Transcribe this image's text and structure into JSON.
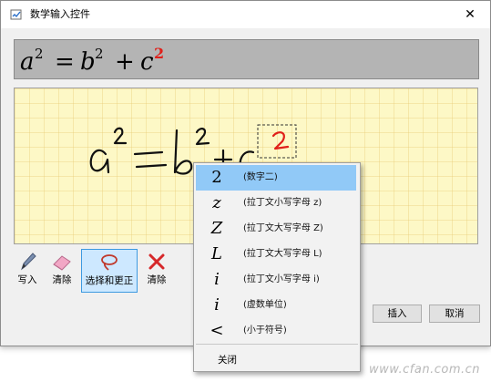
{
  "window": {
    "title": "数学输入控件",
    "close_glyph": "✕"
  },
  "preview": {
    "formula_parts": [
      "a",
      "2",
      "=",
      "b",
      "2",
      "+",
      "c",
      "2"
    ],
    "highlight_color": "#e0201a"
  },
  "toolbar": [
    {
      "label": "写入",
      "icon": "pen-icon",
      "selected": false
    },
    {
      "label": "清除",
      "icon": "eraser-icon",
      "selected": false
    },
    {
      "label": "选择和更正",
      "icon": "lasso-icon",
      "selected": true
    },
    {
      "label": "清除",
      "icon": "x-icon",
      "selected": false
    }
  ],
  "buttons": {
    "insert": "插入",
    "cancel": "取消"
  },
  "context_menu": {
    "items": [
      {
        "glyph": "2",
        "desc": "(数字二)",
        "italic": false,
        "highlighted": true
      },
      {
        "glyph": "z",
        "desc": "(拉丁文小写字母 z)",
        "italic": true,
        "highlighted": false
      },
      {
        "glyph": "Z",
        "desc": "(拉丁文大写字母 Z)",
        "italic": true,
        "highlighted": false
      },
      {
        "glyph": "L",
        "desc": "(拉丁文大写字母 L)",
        "italic": true,
        "highlighted": false
      },
      {
        "glyph": "i",
        "desc": "(拉丁文小写字母 i)",
        "italic": true,
        "highlighted": false
      },
      {
        "glyph": "i",
        "desc": "(虚数单位)",
        "italic": true,
        "highlighted": false
      },
      {
        "glyph": "<",
        "desc": "(小于符号)",
        "italic": false,
        "highlighted": false
      }
    ],
    "close_label": "关闭"
  },
  "watermark": "www.cfan.com.cn",
  "colors": {
    "ink": "#000000",
    "correction": "#e0201a",
    "menu_highlight": "#91c9f7",
    "tool_selected": "#cde8ff"
  }
}
